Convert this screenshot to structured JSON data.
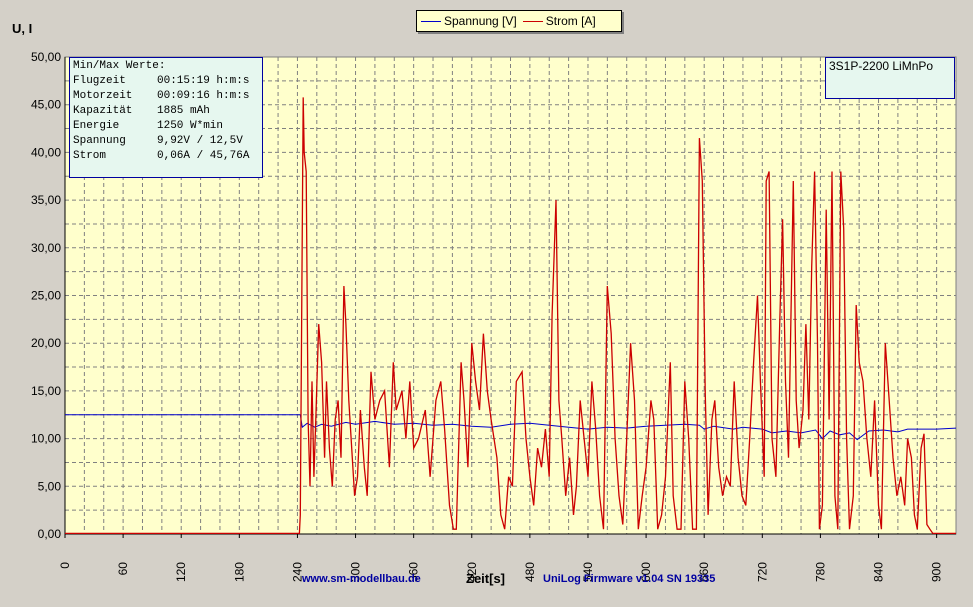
{
  "chart_data": {
    "type": "line",
    "ylabel": "U, I",
    "xlabel": "Zeit[s]",
    "xlim": [
      0,
      920
    ],
    "ylim": [
      0,
      50
    ],
    "x_ticks": [
      "0",
      "60",
      "120",
      "180",
      "240",
      "300",
      "360",
      "420",
      "480",
      "540",
      "600",
      "660",
      "720",
      "780",
      "840",
      "900"
    ],
    "y_ticks": [
      "0,00",
      "5,00",
      "10,00",
      "15,00",
      "20,00",
      "25,00",
      "30,00",
      "35,00",
      "40,00",
      "45,00",
      "50,00"
    ],
    "grid": true,
    "legend_position": "top-center",
    "series": [
      {
        "name": "Spannung [V]",
        "color": "#0000cc",
        "points": [
          [
            0,
            12.5
          ],
          [
            243,
            12.5
          ],
          [
            245,
            11.2
          ],
          [
            250,
            11.6
          ],
          [
            258,
            11.2
          ],
          [
            265,
            11.5
          ],
          [
            275,
            11.3
          ],
          [
            290,
            11.7
          ],
          [
            300,
            11.5
          ],
          [
            320,
            11.8
          ],
          [
            340,
            11.5
          ],
          [
            360,
            11.6
          ],
          [
            380,
            11.4
          ],
          [
            400,
            11.5
          ],
          [
            420,
            11.3
          ],
          [
            440,
            11.2
          ],
          [
            460,
            11.5
          ],
          [
            480,
            11.6
          ],
          [
            500,
            11.4
          ],
          [
            520,
            11.2
          ],
          [
            540,
            11.0
          ],
          [
            560,
            11.2
          ],
          [
            580,
            11.1
          ],
          [
            600,
            11.3
          ],
          [
            620,
            11.4
          ],
          [
            640,
            11.5
          ],
          [
            655,
            11.4
          ],
          [
            660,
            11.0
          ],
          [
            670,
            11.3
          ],
          [
            690,
            11.0
          ],
          [
            700,
            11.2
          ],
          [
            720,
            11.0
          ],
          [
            730,
            10.6
          ],
          [
            745,
            10.8
          ],
          [
            760,
            10.6
          ],
          [
            775,
            10.9
          ],
          [
            782,
            10.0
          ],
          [
            790,
            10.8
          ],
          [
            800,
            10.4
          ],
          [
            810,
            10.6
          ],
          [
            818,
            9.9
          ],
          [
            830,
            10.8
          ],
          [
            845,
            10.9
          ],
          [
            860,
            10.7
          ],
          [
            870,
            11.0
          ],
          [
            900,
            11.0
          ],
          [
            920,
            11.1
          ]
        ]
      },
      {
        "name": "Strom [A]",
        "color": "#cc0000",
        "points": [
          [
            0,
            0.06
          ],
          [
            242,
            0.06
          ],
          [
            243,
            2
          ],
          [
            246,
            45.76
          ],
          [
            247,
            40
          ],
          [
            249,
            38
          ],
          [
            251,
            12
          ],
          [
            253,
            5
          ],
          [
            255,
            16
          ],
          [
            257,
            6
          ],
          [
            259,
            12
          ],
          [
            262,
            22
          ],
          [
            265,
            18
          ],
          [
            268,
            8
          ],
          [
            270,
            16
          ],
          [
            273,
            9
          ],
          [
            276,
            5
          ],
          [
            279,
            12
          ],
          [
            282,
            14
          ],
          [
            285,
            8
          ],
          [
            288,
            26
          ],
          [
            290,
            22
          ],
          [
            293,
            14
          ],
          [
            296,
            9
          ],
          [
            299,
            4
          ],
          [
            302,
            6
          ],
          [
            305,
            13
          ],
          [
            309,
            7
          ],
          [
            312,
            4
          ],
          [
            316,
            17
          ],
          [
            320,
            12
          ],
          [
            325,
            14
          ],
          [
            330,
            15
          ],
          [
            335,
            7
          ],
          [
            339,
            18
          ],
          [
            342,
            13
          ],
          [
            348,
            15
          ],
          [
            352,
            10
          ],
          [
            356,
            16
          ],
          [
            360,
            9
          ],
          [
            365,
            10
          ],
          [
            372,
            13
          ],
          [
            377,
            6
          ],
          [
            383,
            14
          ],
          [
            388,
            16
          ],
          [
            392,
            11
          ],
          [
            397,
            3
          ],
          [
            401,
            0.5
          ],
          [
            404,
            0.5
          ],
          [
            409,
            18
          ],
          [
            412,
            14
          ],
          [
            416,
            7
          ],
          [
            420,
            20
          ],
          [
            424,
            16
          ],
          [
            428,
            13
          ],
          [
            432,
            21
          ],
          [
            436,
            15
          ],
          [
            440,
            12
          ],
          [
            446,
            8
          ],
          [
            450,
            2
          ],
          [
            454,
            0.5
          ],
          [
            458,
            6
          ],
          [
            462,
            5
          ],
          [
            466,
            16
          ],
          [
            472,
            17
          ],
          [
            476,
            10
          ],
          [
            480,
            6
          ],
          [
            484,
            3
          ],
          [
            488,
            9
          ],
          [
            492,
            7
          ],
          [
            496,
            11
          ],
          [
            500,
            6
          ],
          [
            503,
            23
          ],
          [
            507,
            35
          ],
          [
            510,
            14
          ],
          [
            513,
            10
          ],
          [
            517,
            4
          ],
          [
            521,
            8
          ],
          [
            525,
            2
          ],
          [
            528,
            5
          ],
          [
            532,
            14
          ],
          [
            536,
            10
          ],
          [
            540,
            6
          ],
          [
            544,
            16
          ],
          [
            548,
            11
          ],
          [
            552,
            4
          ],
          [
            556,
            0.5
          ],
          [
            560,
            26
          ],
          [
            564,
            21
          ],
          [
            568,
            10
          ],
          [
            572,
            4
          ],
          [
            576,
            1
          ],
          [
            580,
            10
          ],
          [
            584,
            20
          ],
          [
            588,
            14
          ],
          [
            592,
            0.5
          ],
          [
            596,
            4
          ],
          [
            600,
            7
          ],
          [
            605,
            14
          ],
          [
            608,
            12
          ],
          [
            612,
            0.5
          ],
          [
            616,
            2
          ],
          [
            620,
            6
          ],
          [
            625,
            18
          ],
          [
            628,
            4
          ],
          [
            632,
            0.5
          ],
          [
            636,
            0.5
          ],
          [
            640,
            16
          ],
          [
            644,
            10
          ],
          [
            648,
            0.5
          ],
          [
            652,
            0.5
          ],
          [
            655,
            41.5
          ],
          [
            658,
            37
          ],
          [
            661,
            15
          ],
          [
            664,
            2
          ],
          [
            668,
            12
          ],
          [
            671,
            14
          ],
          [
            675,
            7
          ],
          [
            679,
            4
          ],
          [
            683,
            6
          ],
          [
            687,
            5
          ],
          [
            691,
            16
          ],
          [
            695,
            8
          ],
          [
            699,
            4
          ],
          [
            703,
            3
          ],
          [
            707,
            10
          ],
          [
            711,
            18
          ],
          [
            715,
            25
          ],
          [
            718,
            16
          ],
          [
            722,
            6
          ],
          [
            724,
            37
          ],
          [
            727,
            38
          ],
          [
            730,
            10
          ],
          [
            734,
            6
          ],
          [
            738,
            22
          ],
          [
            741,
            33
          ],
          [
            744,
            16
          ],
          [
            747,
            8
          ],
          [
            752,
            37
          ],
          [
            755,
            14
          ],
          [
            758,
            9
          ],
          [
            762,
            13
          ],
          [
            765,
            22
          ],
          [
            768,
            12
          ],
          [
            771,
            28
          ],
          [
            774,
            38
          ],
          [
            777,
            20
          ],
          [
            779,
            0.5
          ],
          [
            782,
            3
          ],
          [
            786,
            34
          ],
          [
            789,
            12
          ],
          [
            792,
            38
          ],
          [
            795,
            4
          ],
          [
            798,
            0.5
          ],
          [
            801,
            38
          ],
          [
            804,
            32
          ],
          [
            807,
            10
          ],
          [
            810,
            0.5
          ],
          [
            814,
            4
          ],
          [
            817,
            24
          ],
          [
            820,
            18
          ],
          [
            824,
            16
          ],
          [
            828,
            10
          ],
          [
            832,
            6
          ],
          [
            836,
            14
          ],
          [
            840,
            3
          ],
          [
            843,
            0.5
          ],
          [
            847,
            20
          ],
          [
            851,
            14
          ],
          [
            855,
            8
          ],
          [
            859,
            4
          ],
          [
            863,
            6
          ],
          [
            867,
            3
          ],
          [
            870,
            10
          ],
          [
            874,
            8
          ],
          [
            877,
            2
          ],
          [
            880,
            0.5
          ],
          [
            884,
            9
          ],
          [
            887,
            10.5
          ],
          [
            890,
            1
          ],
          [
            893,
            0.5
          ],
          [
            896,
            0.06
          ],
          [
            920,
            0.06
          ]
        ]
      }
    ]
  },
  "info": {
    "title": "Min/Max Werte:",
    "rows": [
      {
        "key": "Flugzeit",
        "val": "00:15:19 h:m:s"
      },
      {
        "key": "Motorzeit",
        "val": "00:09:16 h:m:s"
      },
      {
        "key": "Kapazität",
        "val": "1885 mAh"
      },
      {
        "key": "Energie",
        "val": "1250 W*min"
      },
      {
        "key": "Spannung",
        "val": "9,92V / 12,5V"
      },
      {
        "key": "Strom",
        "val": "0,06A / 45,76A"
      }
    ]
  },
  "pack_name": "3S1P-2200 LiMnPo",
  "footer": {
    "left": "www.sm-modellbau.de",
    "right": "UniLog Firmware v1.04 SN 19335"
  }
}
